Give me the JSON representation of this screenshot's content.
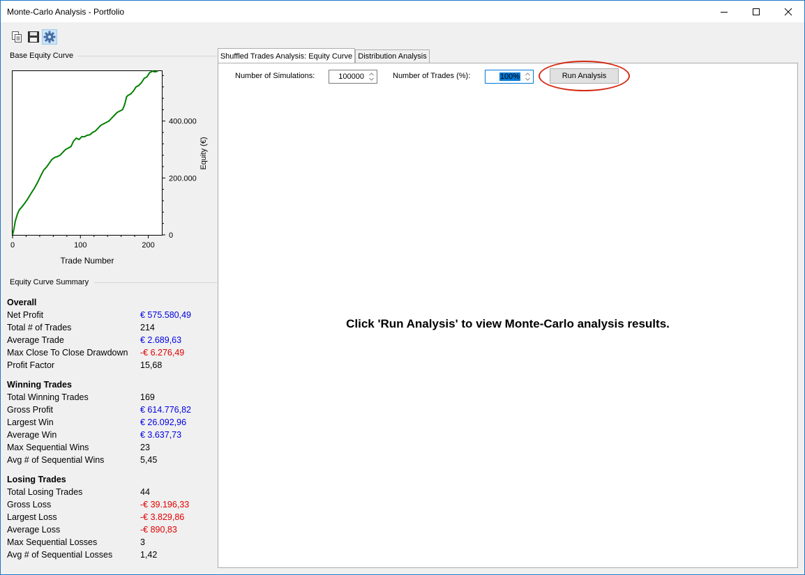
{
  "window": {
    "title": "Monte-Carlo Analysis - Portfolio"
  },
  "toolbar": {
    "icons": [
      "copy-icon",
      "save-icon",
      "settings-icon"
    ]
  },
  "base_equity": {
    "group_label": "Base Equity Curve"
  },
  "chart_data": {
    "type": "line",
    "title": "",
    "xlabel": "Trade Number",
    "ylabel": "Equity (€)",
    "xlim": [
      0,
      220
    ],
    "ylim": [
      0,
      575580.49
    ],
    "x_ticks": [
      0,
      100,
      200
    ],
    "x_tick_labels": [
      "0",
      "100",
      "200"
    ],
    "y_ticks": [
      0,
      200000,
      400000
    ],
    "y_tick_labels": [
      "0",
      "200.000",
      "400.000"
    ],
    "grid": false,
    "legend": "none",
    "colors": {
      "line": "#008000"
    },
    "series": [
      {
        "x": [
          0,
          2,
          4,
          7,
          10,
          13,
          17,
          22,
          27,
          32,
          37,
          42,
          46,
          50,
          52,
          55,
          58,
          62,
          66,
          70,
          74,
          78,
          82,
          86,
          90,
          94,
          98,
          102,
          106,
          110,
          114,
          118,
          122,
          126,
          130,
          134,
          138,
          142,
          146,
          150,
          154,
          158,
          162,
          164,
          166,
          168,
          170,
          174,
          178,
          182,
          186,
          190,
          194,
          198,
          202,
          206,
          210,
          214
        ],
        "y": [
          0,
          20000,
          48000,
          72000,
          88000,
          96000,
          108000,
          125000,
          145000,
          163000,
          185000,
          210000,
          228000,
          238000,
          245000,
          255000,
          265000,
          272000,
          275000,
          280000,
          290000,
          300000,
          305000,
          310000,
          330000,
          340000,
          335000,
          345000,
          345000,
          350000,
          352000,
          360000,
          365000,
          375000,
          385000,
          390000,
          395000,
          400000,
          410000,
          420000,
          430000,
          435000,
          440000,
          450000,
          465000,
          485000,
          490000,
          495000,
          505000,
          520000,
          525000,
          535000,
          550000,
          555000,
          570000,
          575000,
          573000,
          575580
        ]
      }
    ],
    "colors_axis": "#000000"
  },
  "summary": {
    "group_label": "Equity Curve Summary",
    "sections": [
      {
        "title": "Overall",
        "rows": [
          {
            "label": "Net Profit",
            "value": "€ 575.580,49",
            "color": "blue"
          },
          {
            "label": "Total # of Trades",
            "value": "214",
            "color": "black"
          },
          {
            "label": "Average Trade",
            "value": "€ 2.689,63",
            "color": "blue"
          },
          {
            "label": "Max Close To Close Drawdown",
            "value": "-€ 6.276,49",
            "color": "red"
          },
          {
            "label": "Profit Factor",
            "value": "15,68",
            "color": "black"
          }
        ]
      },
      {
        "title": "Winning Trades",
        "rows": [
          {
            "label": "Total Winning Trades",
            "value": "169",
            "color": "black"
          },
          {
            "label": "Gross Profit",
            "value": "€ 614.776,82",
            "color": "blue"
          },
          {
            "label": "Largest Win",
            "value": "€ 26.092,96",
            "color": "blue"
          },
          {
            "label": "Average Win",
            "value": "€ 3.637,73",
            "color": "blue"
          },
          {
            "label": "Max Sequential Wins",
            "value": "23",
            "color": "black"
          },
          {
            "label": "Avg # of Sequential Wins",
            "value": "5,45",
            "color": "black"
          }
        ]
      },
      {
        "title": "Losing Trades",
        "rows": [
          {
            "label": "Total Losing Trades",
            "value": "44",
            "color": "black"
          },
          {
            "label": "Gross Loss",
            "value": "-€ 39.196,33",
            "color": "red"
          },
          {
            "label": "Largest Loss",
            "value": "-€ 3.829,86",
            "color": "red"
          },
          {
            "label": "Average Loss",
            "value": "-€ 890,83",
            "color": "red"
          },
          {
            "label": "Max Sequential Losses",
            "value": "3",
            "color": "black"
          },
          {
            "label": "Avg # of Sequential Losses",
            "value": "1,42",
            "color": "black"
          }
        ]
      }
    ]
  },
  "tabs": [
    {
      "label": "Shuffled Trades Analysis: Equity Curve",
      "active": true
    },
    {
      "label": "Distribution Analysis",
      "active": false
    }
  ],
  "controls": {
    "simulations_label": "Number of Simulations:",
    "simulations_value": "100000",
    "trades_label": "Number of Trades (%):",
    "trades_value": "100%",
    "run_button": "Run Analysis"
  },
  "message": "Click 'Run Analysis' to view Monte-Carlo analysis results.",
  "colors": {
    "highlight_ring": "#d42b14",
    "positive": "#0000e0",
    "negative": "#e00000",
    "line": "#008000"
  }
}
